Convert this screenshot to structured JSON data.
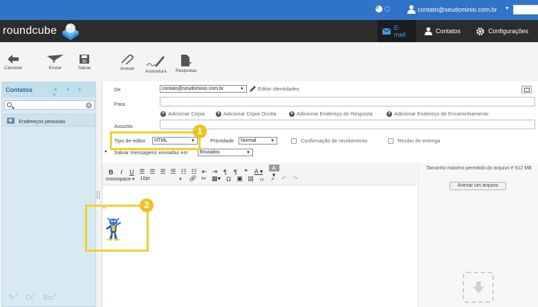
{
  "topbar": {
    "user": "contato@seudominio.com.br"
  },
  "header": {
    "logo": "roundcube",
    "nav": [
      {
        "label": "E-mail"
      },
      {
        "label": "Contatos"
      },
      {
        "label": "Configurações"
      }
    ]
  },
  "toolbar": {
    "cancel": "Cancelar",
    "send": "Enviar",
    "save": "Salvar",
    "attach": "Anexar",
    "signature": "Assinatura",
    "responses": "Respostas"
  },
  "contacts": {
    "title": "Contatos",
    "pager": "◀ ◀ ▶ ▶",
    "item": "Endereços pessoais",
    "to": "To",
    "cc": "Cc",
    "bcc": "Bcc"
  },
  "compose": {
    "from_label": "De",
    "from_value": "contato@seudominio.com.br",
    "edit_identities": "Editar identidades",
    "to_label": "Para",
    "add_cc": "Adicionar Cópia",
    "add_bcc": "Adicionar Cópia Oculta",
    "add_reply_to": "Adicionar Endereço de Resposta",
    "add_followup": "Adicionar Endereço de Encaminhamento",
    "subject_label": "Assunto",
    "editor_type_label": "Tipo de editor",
    "editor_type_value": "HTML",
    "priority_label": "Prioridade",
    "priority_value": "Normal",
    "receipt_label": "Confirmação de recebimento",
    "delivery_label": "Recibo de entrega",
    "save_sent_label": "Salvar mensagens enviadas em",
    "save_sent_value": "Enviados",
    "signature_dashes": "--"
  },
  "editor": {
    "font": "monospace",
    "size": "10pt"
  },
  "attachments": {
    "info": "Tamanho máximo permitido do arquivo é 512 MB",
    "button": "Anexar um arquivo"
  },
  "annotations": {
    "one": "1",
    "two": "2"
  },
  "colors": {
    "topbar": "#2f74c6",
    "header": "#2c2c2c",
    "highlight": "#f2d22a",
    "badge": "#f2c21c",
    "panel": "#d7eaf3"
  }
}
